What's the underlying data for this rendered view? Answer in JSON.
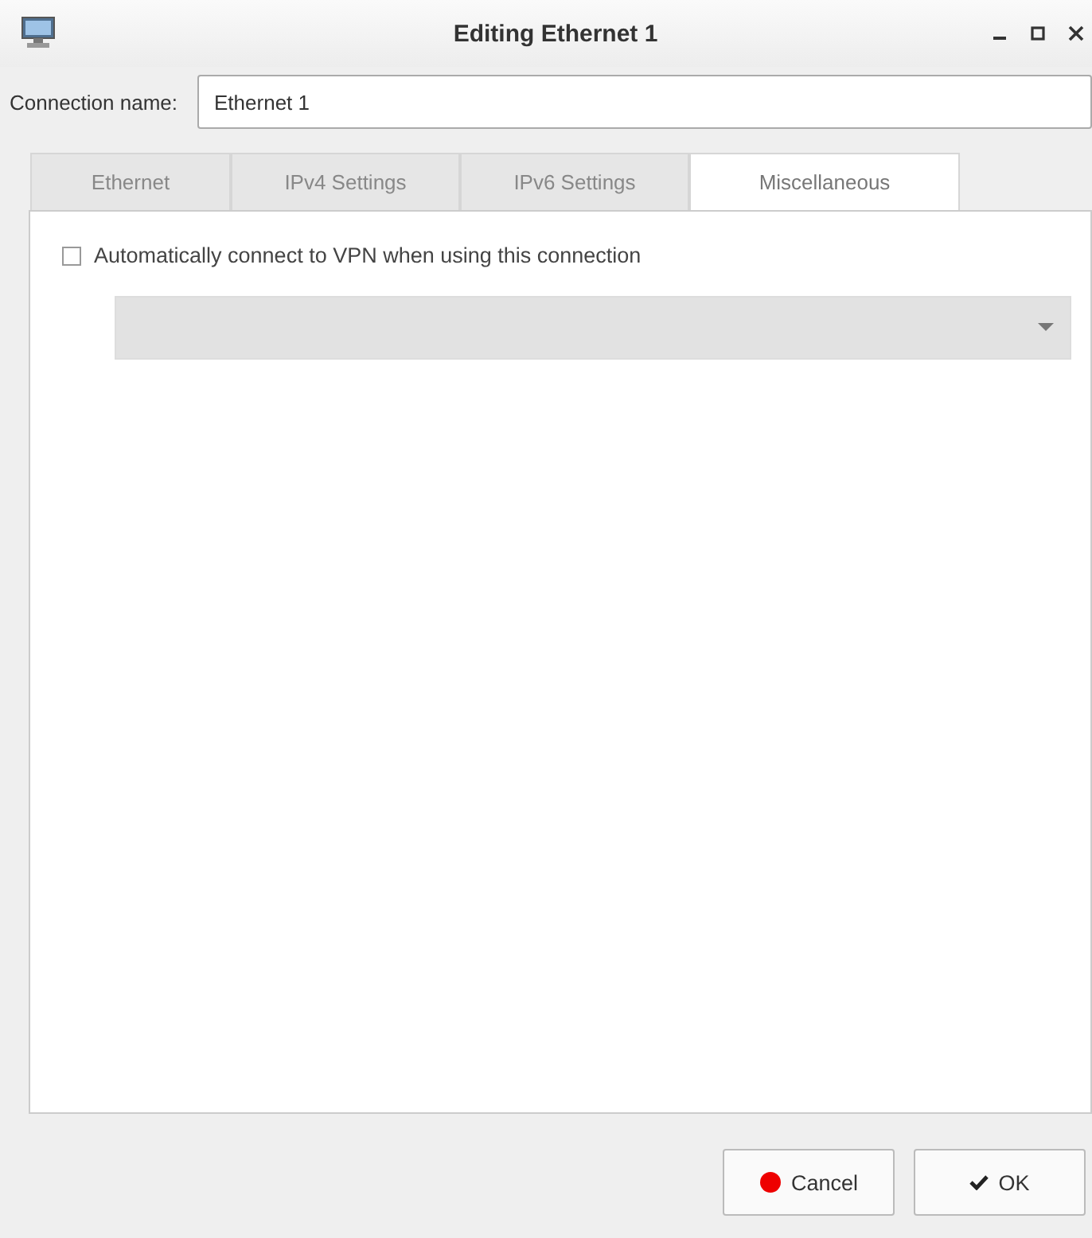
{
  "window": {
    "title": "Editing Ethernet 1"
  },
  "connection_name": {
    "label": "Connection name:",
    "value": "Ethernet 1"
  },
  "tabs": [
    {
      "label": "Ethernet",
      "selected": false
    },
    {
      "label": "IPv4 Settings",
      "selected": false
    },
    {
      "label": "IPv6 Settings",
      "selected": false
    },
    {
      "label": "Miscellaneous",
      "selected": true
    }
  ],
  "auto_vpn": {
    "label": "Automatically connect to VPN when using this connection",
    "checked": false
  },
  "vpn_dropdown": {
    "disabled": true
  },
  "buttons": [
    {
      "kind": "cancel",
      "label": "Cancel"
    },
    {
      "kind": "ok",
      "label": "OK"
    }
  ]
}
